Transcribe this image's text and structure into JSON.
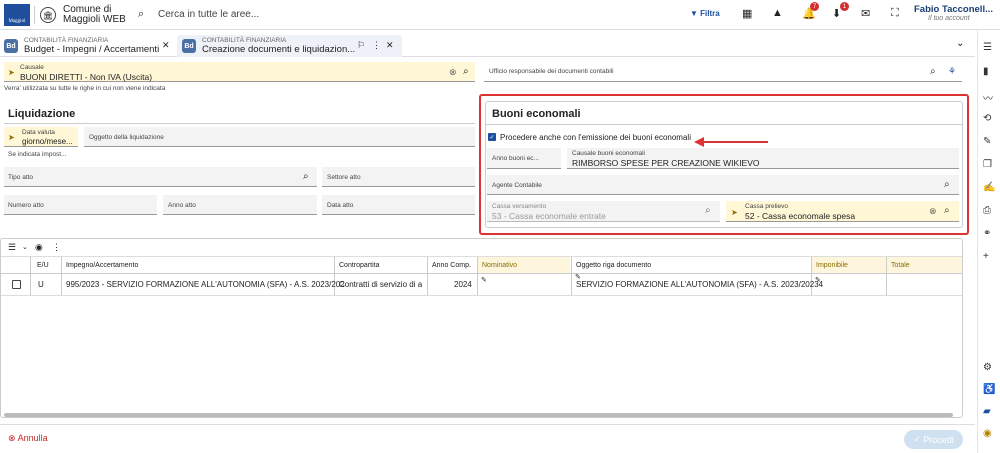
{
  "header": {
    "logo_text": "Maggiol",
    "app_name_line1": "Comune di",
    "app_name_line2": "Maggioli WEB",
    "search_placeholder": "Cerca in tutte le aree...",
    "filter_label": "Filtra",
    "badge_notifications": "7",
    "badge_downloads": "1",
    "user_name": "Fabio Tacconell...",
    "user_sub": "Il tuo account"
  },
  "tabs": [
    {
      "icon": "Bd",
      "category": "CONTABILITÀ FINANZIARIA",
      "title": "Budget - Impegni / Accertamenti"
    },
    {
      "icon": "Bd",
      "category": "CONTABILITÀ FINANZIARIA",
      "title": "Creazione documenti e liquidazion..."
    }
  ],
  "causale": {
    "label": "Causale",
    "value": "BUONI DIRETTI - Non IVA (Uscita)",
    "note": "Verra' utilizzata su tutte le righe in cui non viene indicata"
  },
  "ufficio": {
    "label": "Ufficio responsabile dei documenti contabili"
  },
  "liquidazione": {
    "title": "Liquidazione",
    "data_valuta_label1": "Data valuta",
    "data_valuta_label2": "giorno/mese...",
    "oggetto_label": "Oggetto della liquidazione",
    "impost_note": "Se indicata impost...",
    "tipo_atto": "Tipo atto",
    "settore_atto": "Settore atto",
    "numero_atto": "Numero atto",
    "anno_atto": "Anno atto",
    "data_atto": "Data atto"
  },
  "buoni": {
    "title": "Buoni economali",
    "checkbox_label": "Procedere anche con l'emissione dei buoni economali",
    "anno_label": "Anno buoni ec...",
    "causale_label": "Causale buoni economali",
    "causale_value": "RIMBORSO SPESE PER CREAZIONE WIKIEVO",
    "agente_label": "Agente Contabile",
    "versamento_label": "Cassa versamento",
    "versamento_value": "53 - Cassa economale entrate",
    "prelievo_label": "Cassa prelievo",
    "prelievo_value": "52 - Cassa economale spesa"
  },
  "grid": {
    "headers": [
      "E/U",
      "Impegno/Accertamento",
      "Contropartita",
      "Anno Comp.",
      "Nominativo",
      "Oggetto riga documento",
      "Imponibile",
      "Totale"
    ],
    "row": {
      "eu": "U",
      "impegno": "995/2023 - SERVIZIO FORMAZIONE ALL'AUTONOMIA (SFA) - A.S. 2023/202",
      "contropartita": "Contratti di servizio di a",
      "anno": "2024",
      "oggetto": "SERVIZIO FORMAZIONE ALL'AUTONOMIA (SFA) - A.S. 2023/20234"
    }
  },
  "footer": {
    "annulla": "Annulla",
    "procedi": "Procedi"
  },
  "colors": {
    "accent": "#1a4fa0",
    "highlight": "#d33333",
    "yellow_field": "#fff7d6"
  }
}
